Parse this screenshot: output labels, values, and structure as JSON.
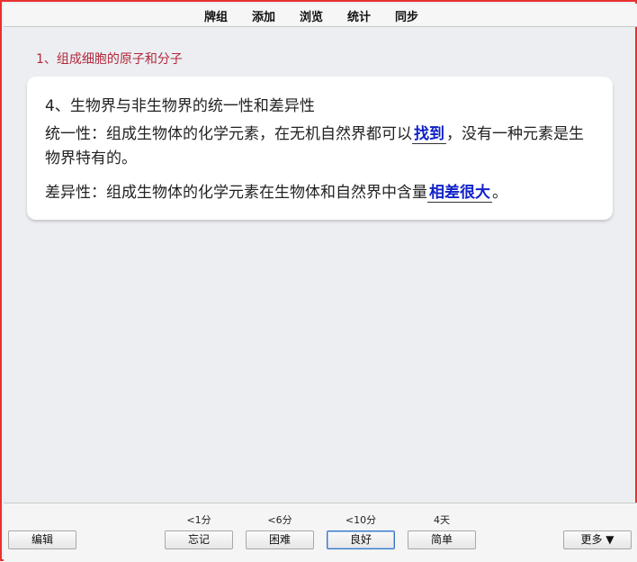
{
  "menu": {
    "decks": "牌组",
    "add": "添加",
    "browse": "浏览",
    "stats": "统计",
    "sync": "同步"
  },
  "deck_title": "1、组成细胞的原子和分子",
  "card": {
    "heading": "4、生物界与非生物界的统一性和差异性",
    "line1_prefix": "统一性：组成生物体的化学元素，在无机自然界都可以",
    "line1_cloze": "找到",
    "line1_suffix": "，没有一种元素是生物界特有的。",
    "line2_prefix": "差异性：组成生物体的化学元素在生物体和自然界中含量",
    "line2_cloze": "相差很大",
    "line2_suffix": "。",
    "cloze_color": "#1022c8"
  },
  "bottom": {
    "edit_label": "编辑",
    "more_label": "更多 ▼",
    "answers": [
      {
        "interval": "<1分",
        "label": "忘记"
      },
      {
        "interval": "<6分",
        "label": "困难"
      },
      {
        "interval": "<10分",
        "label": "良好"
      },
      {
        "interval": "4天",
        "label": "简单"
      }
    ]
  },
  "colors": {
    "frame_border": "#e8312f",
    "background": "#eceef2",
    "deck_title": "#b2283a"
  }
}
